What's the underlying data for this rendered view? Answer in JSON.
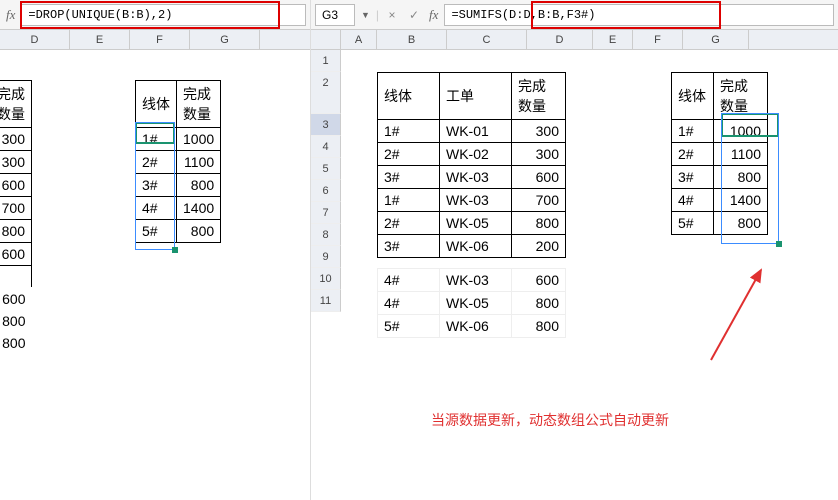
{
  "left": {
    "fx_label": "fx",
    "formula": "=DROP(UNIQUE(B:B),2)",
    "col_headers": [
      "D",
      "E",
      "F",
      "G"
    ],
    "row_headers": [],
    "partial_table": {
      "header": "完成\n数量",
      "rows": [
        "300",
        "300",
        "600",
        "700",
        "800",
        "600",
        "",
        "600",
        "800",
        "800"
      ]
    },
    "summary_table": {
      "h1": "线体",
      "h2": "完成\n数量",
      "rows": [
        {
          "a": "1#",
          "b": "1000"
        },
        {
          "a": "2#",
          "b": "1100"
        },
        {
          "a": "3#",
          "b": "800"
        },
        {
          "a": "4#",
          "b": "1400"
        },
        {
          "a": "5#",
          "b": "800"
        }
      ]
    }
  },
  "right": {
    "namebox": "G3",
    "fx_label": "fx",
    "cancel_icon": "×",
    "enter_icon": "✓",
    "formula": "=SUMIFS(D:D,B:B,F3#)",
    "col_headers": [
      "A",
      "B",
      "C",
      "D",
      "E",
      "F",
      "G"
    ],
    "row_headers": [
      "1",
      "2",
      "3",
      "4",
      "5",
      "6",
      "7",
      "8",
      "9",
      "10",
      "11"
    ],
    "source_table": {
      "h1": "线体",
      "h2": "工单",
      "h3": "完成\n数量",
      "rows": [
        {
          "a": "1#",
          "b": "WK-01",
          "c": "300"
        },
        {
          "a": "2#",
          "b": "WK-02",
          "c": "300"
        },
        {
          "a": "3#",
          "b": "WK-03",
          "c": "600"
        },
        {
          "a": "1#",
          "b": "WK-03",
          "c": "700"
        },
        {
          "a": "2#",
          "b": "WK-05",
          "c": "800"
        },
        {
          "a": "3#",
          "b": "WK-06",
          "c": "200"
        }
      ],
      "extra": [
        {
          "a": "4#",
          "b": "WK-03",
          "c": "600"
        },
        {
          "a": "4#",
          "b": "WK-05",
          "c": "800"
        },
        {
          "a": "5#",
          "b": "WK-06",
          "c": "800"
        }
      ]
    },
    "summary_table": {
      "h1": "线体",
      "h2": "完成\n数量",
      "rows": [
        {
          "a": "1#",
          "b": "1000"
        },
        {
          "a": "2#",
          "b": "1100"
        },
        {
          "a": "3#",
          "b": "800"
        },
        {
          "a": "4#",
          "b": "1400"
        },
        {
          "a": "5#",
          "b": "800"
        }
      ]
    },
    "caption": "当源数据更新，动态数组公式自动更新"
  }
}
